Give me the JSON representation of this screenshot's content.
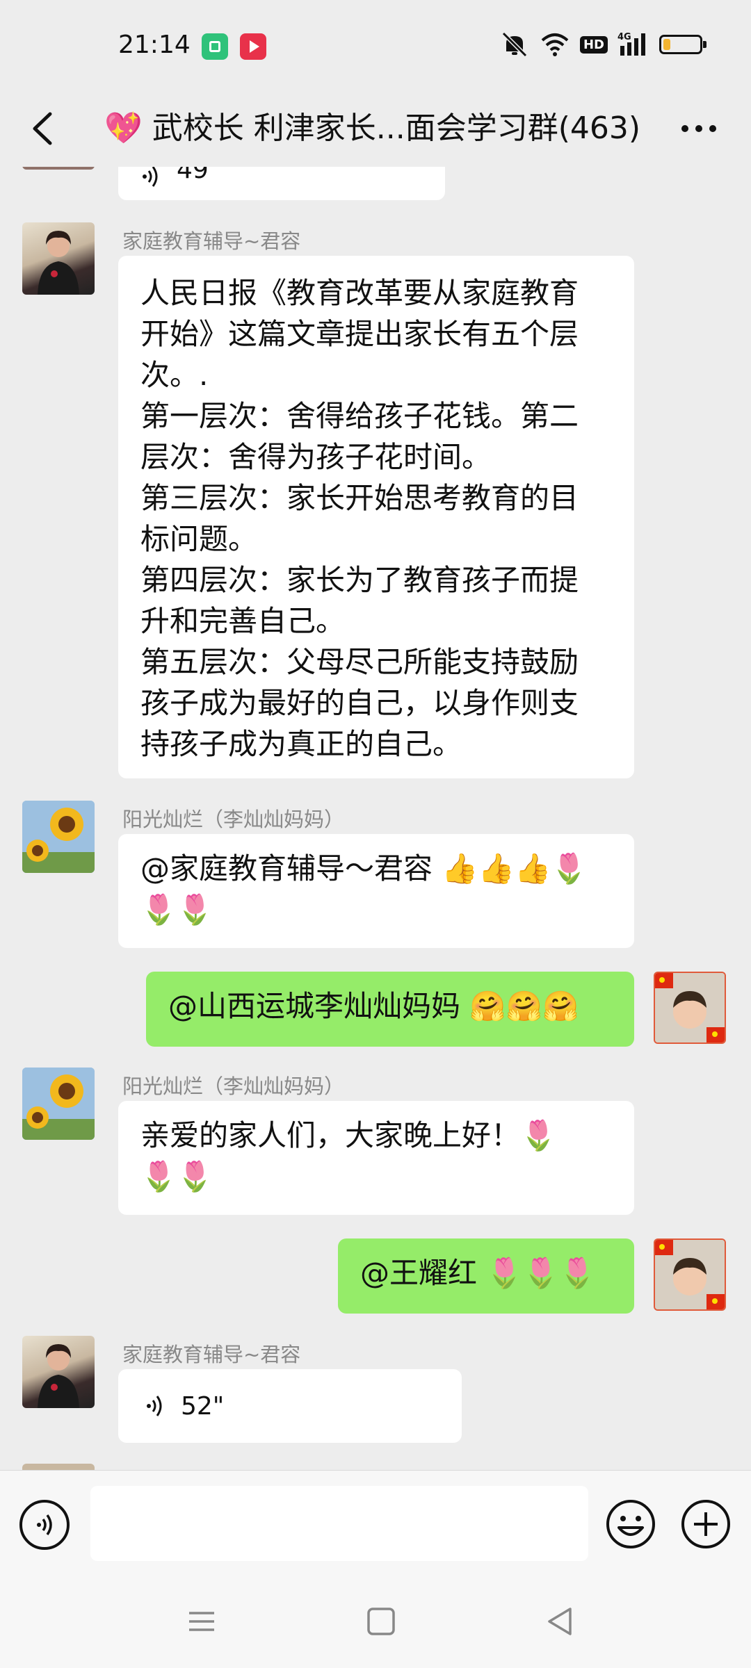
{
  "status_bar": {
    "time": "21:14",
    "network_label": "4G",
    "hd_label": "HD",
    "battery_level": 0.2,
    "icons": [
      "app-badge-icon",
      "video-app-icon",
      "mute-icon",
      "wifi-icon",
      "hd-icon",
      "signal-icon",
      "battery-icon"
    ]
  },
  "header": {
    "title": "💖 武校长 利津家长...面会学习群(463)",
    "back_icon": "chevron-left-icon",
    "more_icon": "more-dots-icon"
  },
  "messages": [
    {
      "id": "voice-partial",
      "type": "voice",
      "duration": "49\"",
      "from_self": false
    },
    {
      "id": "msg-article",
      "sender": "家庭教育辅导~君容",
      "from_self": false,
      "lines": [
        "人民日报《教育改革要从家庭教育",
        "开始》这篇文章提出家长有五个层",
        "次。.",
        "第一层次：舍得给孩子花钱。第二",
        "层次：舍得为孩子花时间。",
        "第三层次：家长开始思考教育的目",
        "标问题。",
        "第四层次：家长为了教育孩子而提",
        "升和完善自己。",
        "第五层次：父母尽己所能支持鼓励",
        "孩子成为最好的自己，以身作则支",
        "持孩子成为真正的自己。"
      ]
    },
    {
      "id": "msg-sunflower-1",
      "sender": "阳光灿烂（李灿灿妈妈）",
      "from_self": false,
      "lines": [
        "@家庭教育辅导～君容 👍👍👍🌷",
        "🌷🌷"
      ]
    },
    {
      "id": "msg-self-1",
      "from_self": true,
      "lines": [
        "@山西运城李灿灿妈妈 🤗🤗🤗"
      ]
    },
    {
      "id": "msg-sunflower-2",
      "sender": "阳光灿烂（李灿灿妈妈）",
      "from_self": false,
      "lines": [
        "亲爱的家人们，大家晚上好！🌷",
        "🌷🌷"
      ]
    },
    {
      "id": "msg-self-2",
      "from_self": true,
      "lines": [
        "@王耀红 🌷🌷🌷"
      ]
    },
    {
      "id": "voice-52",
      "sender": "家庭教育辅导~君容",
      "type": "voice",
      "duration": "52\"",
      "from_self": false
    }
  ],
  "input_bar": {
    "value": "",
    "voice_icon": "voice-mode-icon",
    "emoji_icon": "emoji-icon",
    "plus_icon": "plus-icon"
  },
  "nav_bar": {
    "icons": [
      "menu-icon",
      "home-icon",
      "back-triangle-icon"
    ]
  },
  "colors": {
    "background": "#ededed",
    "self_bubble": "#95ec69",
    "other_bubble": "#ffffff",
    "sender_name": "#888888"
  }
}
